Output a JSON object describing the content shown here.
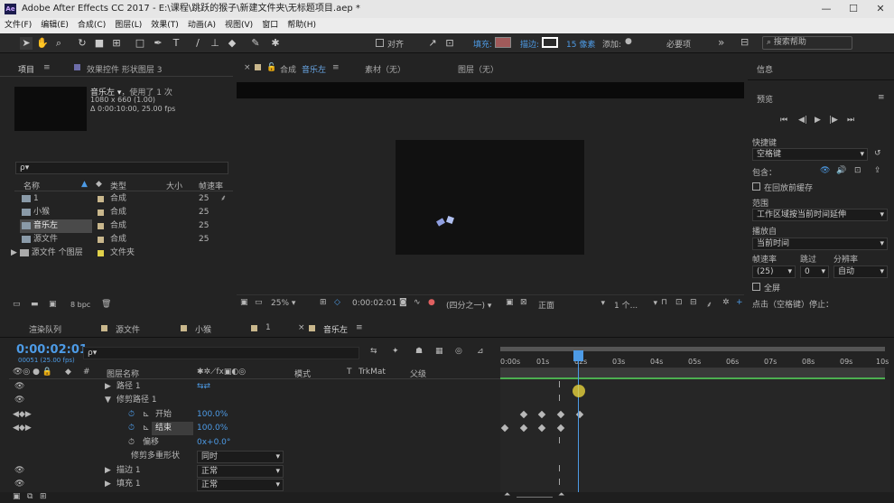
{
  "window": {
    "title": "Adobe After Effects CC 2017 - E:\\课程\\跳跃的猴子\\新建文件夹\\无标题项目.aep *",
    "app_badge": "Ae",
    "minimize": "—",
    "maximize": "☐",
    "close": "✕"
  },
  "menu": [
    "文件(F)",
    "编辑(E)",
    "合成(C)",
    "图层(L)",
    "效果(T)",
    "动画(A)",
    "视图(V)",
    "窗口",
    "帮助(H)"
  ],
  "toolbar": {
    "align_label": "对齐",
    "fill_label": "填充:",
    "stroke_label": "描边:",
    "stroke_px": "15 像素",
    "add_label": "添加:",
    "essentials_label": "必要项",
    "search_help": "搜索帮助",
    "fill_color": "#a05a5a",
    "stroke_color": "#ffffff"
  },
  "project_panel": {
    "tab_project": "项目",
    "tab_effects": "效果控件 形状图层 3",
    "comp_name": "音乐左",
    "used_times": "，使用了 1 次",
    "dims": "1080 x 660 (1.00)",
    "duration": "Δ 0:00:10:00, 25.00 fps",
    "search_placeholder": "ρ▾",
    "col_name": "名称",
    "col_type": "类型",
    "col_size": "大小",
    "col_fps": "帧速率",
    "items": [
      {
        "name": "1",
        "type": "合成",
        "fps": "25"
      },
      {
        "name": "小猴",
        "type": "合成",
        "fps": "25"
      },
      {
        "name": "音乐左",
        "type": "合成",
        "fps": "25"
      },
      {
        "name": "源文件",
        "type": "合成",
        "fps": "25"
      },
      {
        "name": "源文件 个图层",
        "type": "文件夹",
        "fps": ""
      }
    ],
    "bpc": "8 bpc"
  },
  "comp_panel": {
    "tab_comp_prefix": "合成",
    "tab_comp_name": "音乐左",
    "tab_footage": "素材（无）",
    "tab_layer": "图层（无）",
    "zoom": "25%",
    "timecode": "0:00:02:01",
    "resolution": "(四分之一)",
    "view": "正面",
    "views_count": "1 个..."
  },
  "right_panel": {
    "info": "信息",
    "preview": "预览",
    "shortcut_label": "快捷键",
    "shortcut_value": "空格键",
    "include_label": "包含：",
    "cache_label": "在回放前缓存",
    "range_label": "范围",
    "range_value": "工作区域按当前时间延伸",
    "play_from_label": "播放自",
    "play_from_value": "当前时间",
    "framerate_label": "帧速率",
    "skip_label": "跳过",
    "resolution_label": "分辨率",
    "framerate_value": "(25)",
    "skip_value": "0",
    "resolution_value": "自动",
    "fullscreen_label": "全屏",
    "stop_label": "点击（空格键）停止："
  },
  "timeline": {
    "tabs": [
      "渲染队列",
      "源文件",
      "小猴",
      "1",
      "音乐左"
    ],
    "timecode": "0:00:02:01",
    "frame_info": "00051 (25.00 fps)",
    "search_placeholder": "ρ▾",
    "col_layer_name": "图层名称",
    "col_mode": "模式",
    "col_t": "T",
    "col_trkmat": "TrkMat",
    "col_parent": "父级",
    "ruler": [
      "0:00s",
      "01s",
      "02s",
      "03s",
      "04s",
      "05s",
      "06s",
      "07s",
      "08s",
      "09s",
      "10s"
    ],
    "layers": [
      {
        "indent": 1,
        "arrow": "▶",
        "name": "路径 1",
        "value": ""
      },
      {
        "indent": 1,
        "arrow": "▼",
        "name": "修剪路径 1",
        "value": ""
      },
      {
        "indent": 2,
        "arrow": "",
        "name": "开始",
        "value": "100.0%"
      },
      {
        "indent": 2,
        "arrow": "",
        "name": "结束",
        "value": "100.0%"
      },
      {
        "indent": 2,
        "arrow": "",
        "name": "偏移",
        "value": "0x+0.0°"
      },
      {
        "indent": 2,
        "arrow": "",
        "name": "修剪多重形状",
        "value": "同时"
      },
      {
        "indent": 1,
        "arrow": "▶",
        "name": "描边 1",
        "value": "正常"
      },
      {
        "indent": 1,
        "arrow": "▶",
        "name": "填充 1",
        "value": "正常"
      }
    ]
  }
}
